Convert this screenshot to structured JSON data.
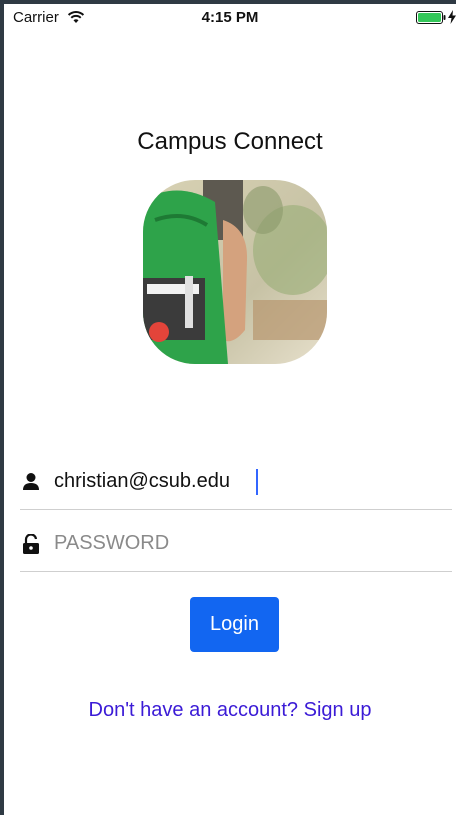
{
  "status_bar": {
    "carrier": "Carrier",
    "time": "4:15 PM"
  },
  "app": {
    "title": "Campus Connect"
  },
  "login_form": {
    "email_value": "christian@csub.edu",
    "password_placeholder": "PASSWORD",
    "login_label": "Login",
    "signup_text": "Don't have an account? Sign up"
  },
  "icons": {
    "wifi": "wifi-icon",
    "battery": "battery-icon",
    "charging": "charging-bolt-icon",
    "user": "user-icon",
    "lock": "unlocked-padlock-icon"
  },
  "colors": {
    "button": "#1266f1",
    "link": "#3b1bd6",
    "battery": "#33c759"
  }
}
